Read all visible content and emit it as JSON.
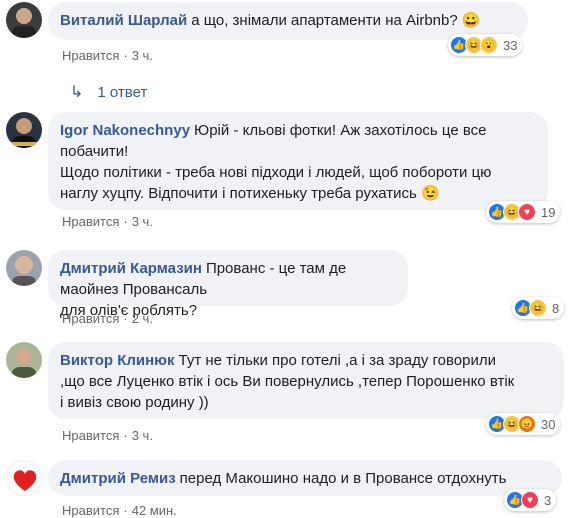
{
  "comments": [
    {
      "author": "Виталий Шарлай",
      "text": "а що, знімали апартаменти на Airbnb? 😀",
      "like_label": "Нравится",
      "time": "3 ч.",
      "reaction_count": "33",
      "reactions": [
        "like",
        "haha",
        "wow"
      ]
    },
    {
      "author": "Igor Nakonechnyy",
      "text_lines": [
        "Юрій - кльові фотки! Аж захотілось це все",
        "побачити!",
        "Щодо політики - треба нові підходи і людей, щоб побороти цю",
        "наглу хуцпу. Відпочити і потихеньку треба рухатись 😉"
      ],
      "like_label": "Нравится",
      "time": "3 ч.",
      "reaction_count": "19",
      "reactions": [
        "like",
        "haha",
        "love"
      ]
    },
    {
      "author": "Дмитрий Кармазин",
      "text_lines": [
        "Прованс - це там де маойнез Провансаль",
        "для олів'є роблять?"
      ],
      "like_label": "Нравится",
      "time": "2 ч.",
      "reaction_count": "8",
      "reactions": [
        "like",
        "haha"
      ]
    },
    {
      "author": "Виктор Клинюк",
      "text_lines": [
        "Тут не тільки про готелі ,а і за зраду говорили",
        ",що все Луценко втік і ось Ви повернулись ,тепер Порошенко втік",
        "і вивіз свою родину ))"
      ],
      "like_label": "Нравится",
      "time": "3 ч.",
      "reaction_count": "30",
      "reactions": [
        "like",
        "haha",
        "angry"
      ]
    },
    {
      "author": "Дмитрий Ремиз",
      "text": "перед Макошино надо и в Провансе отдохнуть",
      "like_label": "Нравится",
      "time": "42 мин.",
      "reaction_count": "3",
      "reactions": [
        "like",
        "love"
      ]
    }
  ],
  "reply_link": {
    "arrow": "↳",
    "label": "1 ответ"
  },
  "colors": {
    "author": "#385898",
    "bubble": "#f0f2f5",
    "meta": "#65676b",
    "like_reaction": "#1877f2"
  }
}
